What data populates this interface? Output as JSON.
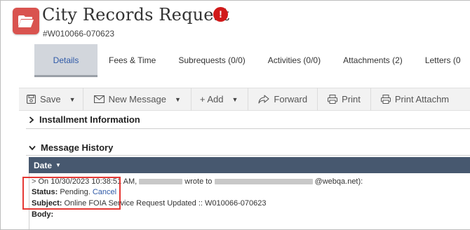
{
  "header": {
    "title": "City Records Request",
    "record_id": "#W010066-070623",
    "alert_symbol": "!"
  },
  "tabs": [
    {
      "label": "Details",
      "active": true
    },
    {
      "label": "Fees & Time"
    },
    {
      "label": "Subrequests (0/0)"
    },
    {
      "label": "Activities (0/0)"
    },
    {
      "label": "Attachments (2)"
    },
    {
      "label": "Letters (0"
    }
  ],
  "toolbar": {
    "save": "Save",
    "new_message": "New Message",
    "add": "+ Add",
    "forward": "Forward",
    "print": "Print",
    "print_attachments": "Print Attachm"
  },
  "sections": {
    "installment": "Installment Information",
    "message_history": "Message History"
  },
  "message_table": {
    "date_header": "Date",
    "line1_prefix": "On 10/30/2023 10:38:51 AM,",
    "line1_mid": "wrote to",
    "line1_suffix": "@webqa.net):",
    "status_label": "Status:",
    "status_value": "Pending.",
    "cancel_link": "Cancel",
    "subject_label": "Subject:",
    "subject_value": "Online FOIA Service Request Updated :: W010066-070623",
    "body_label": "Body:"
  },
  "colors": {
    "accent_blue": "#2f5aa8",
    "header_dark": "#47586f",
    "alert_red": "#d11a1a",
    "folder_red": "#d9534f",
    "highlight_red": "#e53935"
  }
}
